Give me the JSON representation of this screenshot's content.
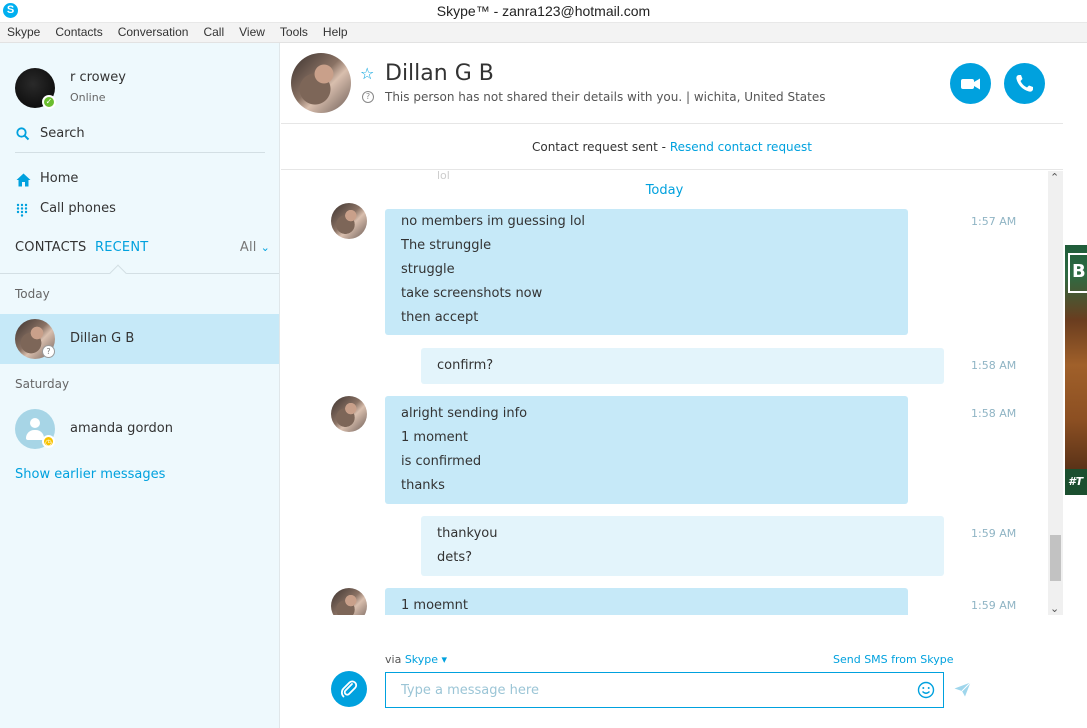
{
  "window": {
    "title": "Skype™ - zanra123@hotmail.com",
    "app_icon_letter": "S"
  },
  "menu": [
    "Skype",
    "Contacts",
    "Conversation",
    "Call",
    "View",
    "Tools",
    "Help"
  ],
  "profile": {
    "name": "r crowey",
    "status": "Online"
  },
  "sidebar": {
    "search_label": "Search",
    "nav": [
      {
        "label": "Home",
        "icon": "home-icon"
      },
      {
        "label": "Call phones",
        "icon": "dialpad-icon"
      }
    ],
    "tabs": {
      "contacts": "CONTACTS",
      "recent": "RECENT",
      "filter": "All"
    },
    "sections": [
      {
        "label": "Today",
        "items": [
          {
            "name": "Dillan G B",
            "status": "unknown"
          }
        ]
      },
      {
        "label": "Saturday",
        "items": [
          {
            "name": "amanda gordon",
            "status": "pending"
          }
        ]
      }
    ],
    "show_earlier": "Show earlier messages"
  },
  "conversation": {
    "contact_name": "Dillan G B",
    "info": "This person has not shared their details with you.  |  wichita, United States",
    "request_text": "Contact request sent - ",
    "request_link": "Resend contact request",
    "date_divider": "Today",
    "faint_text": "lol",
    "messages": [
      {
        "from": "them",
        "time": "1:57 AM",
        "lines": [
          "no members im guessing lol",
          "The strunggle",
          "struggle",
          "take screenshots now",
          "then accept"
        ]
      },
      {
        "from": "me",
        "time": "1:58 AM",
        "lines": [
          "confirm?"
        ]
      },
      {
        "from": "them",
        "time": "1:58 AM",
        "lines": [
          "alright sending info",
          "1 moment",
          "is confirmed",
          "thanks"
        ]
      },
      {
        "from": "me",
        "time": "1:59 AM",
        "lines": [
          "thankyou",
          "dets?"
        ]
      },
      {
        "from": "them",
        "time": "1:59 AM",
        "lines": [
          "1 moemnt"
        ]
      }
    ]
  },
  "compose": {
    "via_label": "via ",
    "via_link": "Skype",
    "sms_link": "Send SMS from Skype",
    "placeholder": "Type a message here"
  },
  "ad": {
    "tag": "#T"
  },
  "colors": {
    "accent": "#00a1de",
    "sidebar_bg": "#eef9fd",
    "incoming_bubble": "#c6e9f8",
    "outgoing_bubble": "#e3f4fb",
    "online": "#6bbe2f",
    "pending": "#f8c300"
  }
}
